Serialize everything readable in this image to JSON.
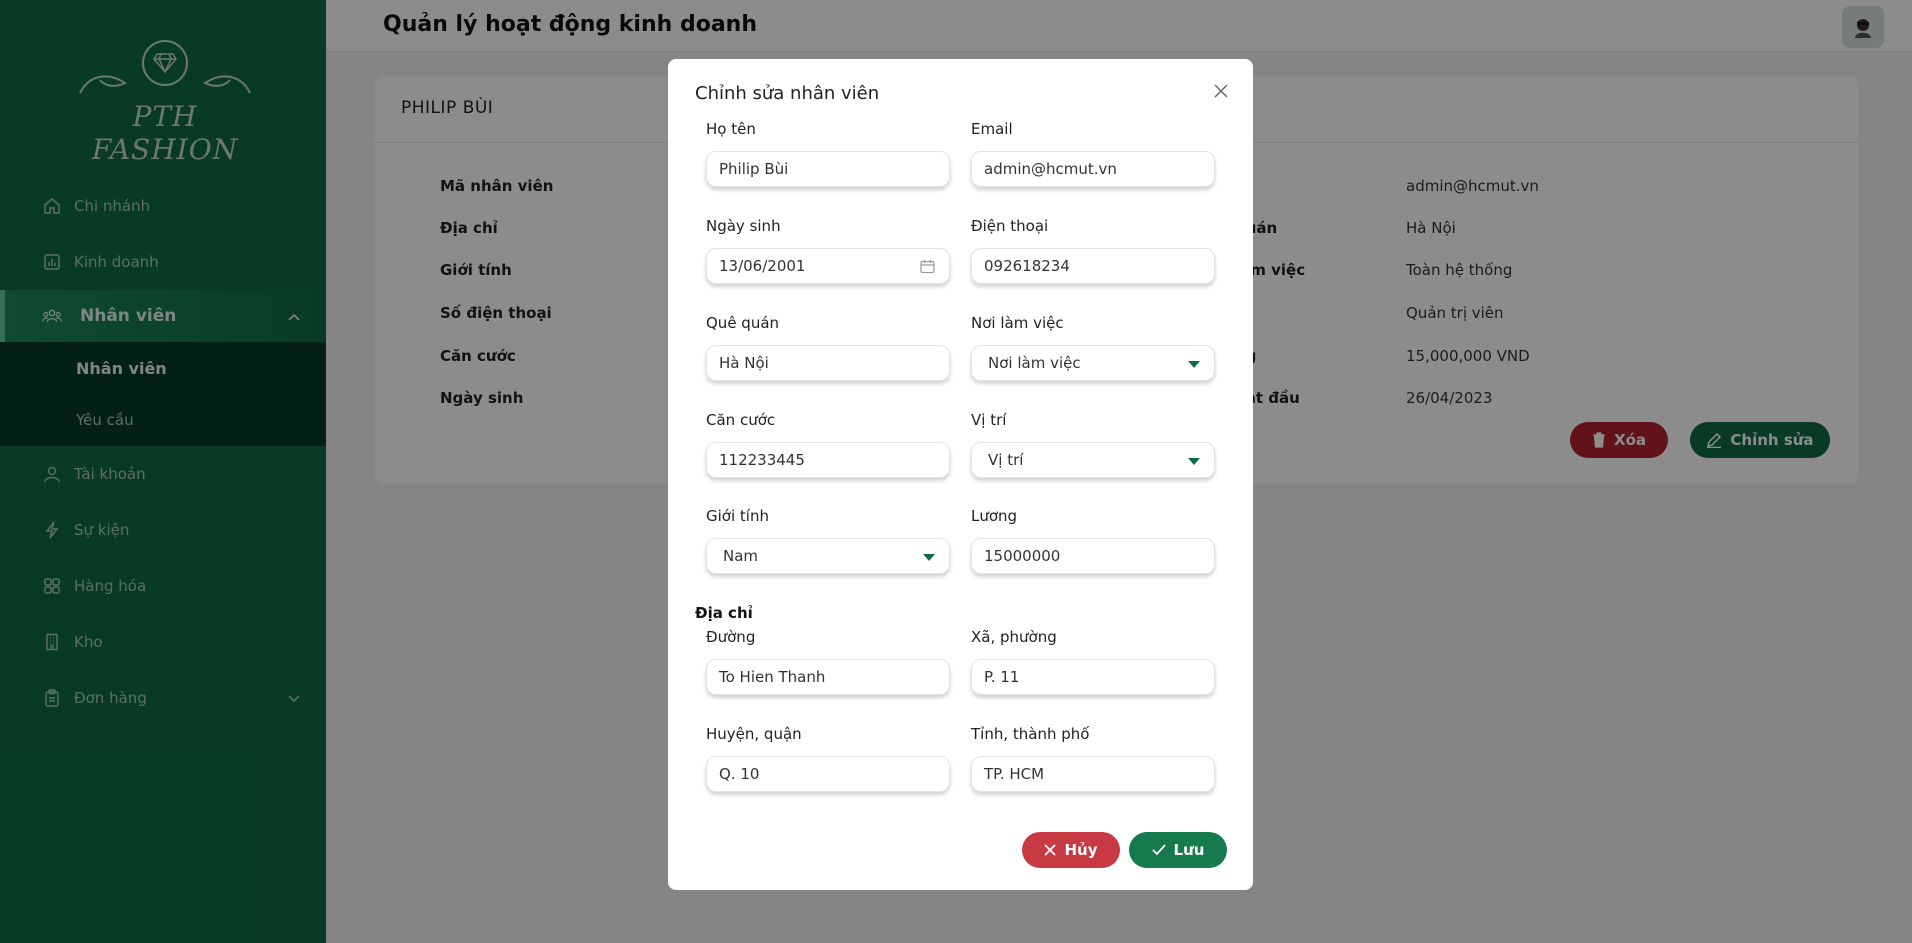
{
  "app": {
    "brand": "PTH FASHION",
    "header_title": "Quản lý hoạt động kinh doanh"
  },
  "sidebar": {
    "items": [
      {
        "label": "Chi nhánh",
        "icon": "home-icon"
      },
      {
        "label": "Kinh doanh",
        "icon": "bar-chart-icon"
      },
      {
        "label": "Nhân viên",
        "icon": "users-icon",
        "active": true
      },
      {
        "label": "Tài khoản",
        "icon": "user-icon"
      },
      {
        "label": "Sự kiện",
        "icon": "lightning-icon"
      },
      {
        "label": "Hàng hóa",
        "icon": "grid-icon"
      },
      {
        "label": "Kho",
        "icon": "building-icon"
      },
      {
        "label": "Đơn hàng",
        "icon": "clipboard-icon"
      }
    ],
    "subitems": [
      {
        "label": "Nhân viên",
        "active": true
      },
      {
        "label": "Yêu cầu"
      }
    ]
  },
  "detail": {
    "name": "PHILIP BÙI",
    "left_labels": [
      "Mã nhân viên",
      "Địa chỉ",
      "Giới tính",
      "Số điện thoại",
      "Căn cước",
      "Ngày sinh"
    ],
    "right_labels": [
      "",
      "quán",
      "làm việc",
      "",
      "ng",
      "bắt đầu"
    ],
    "right_values": [
      "admin@hcmut.vn",
      "Hà Nội",
      "Toàn hệ thống",
      "Quản trị viên",
      "15,000,000 VND",
      "26/04/2023"
    ],
    "delete_label": "Xóa",
    "edit_label": "Chỉnh sửa"
  },
  "modal": {
    "title": "Chỉnh sửa nhân viên",
    "fields": {
      "name": {
        "label": "Họ tên",
        "value": "Philip Bùi"
      },
      "email": {
        "label": "Email",
        "value": "admin@hcmut.vn"
      },
      "dob": {
        "label": "Ngày sinh",
        "value": "13/06/2001"
      },
      "phone": {
        "label": "Điện thoại",
        "value": "092618234"
      },
      "hometown": {
        "label": "Quê quán",
        "value": "Hà Nội"
      },
      "workplace": {
        "label": "Nơi làm việc",
        "value": "Nơi làm việc"
      },
      "id_card": {
        "label": "Căn cước",
        "value": "112233445"
      },
      "position": {
        "label": "Vị trí",
        "value": "Vị trí"
      },
      "gender": {
        "label": "Giới tính",
        "value": "Nam"
      },
      "salary": {
        "label": "Lương",
        "value": "15000000"
      }
    },
    "address_section": "Địa chỉ",
    "address": {
      "street": {
        "label": "Đường",
        "value": "To Hien Thanh"
      },
      "ward": {
        "label": "Xã, phường",
        "value": "P. 11"
      },
      "district": {
        "label": "Huyện, quận",
        "value": "Q. 10"
      },
      "city": {
        "label": "Tỉnh, thành phố",
        "value": "TP. HCM"
      }
    },
    "cancel_label": "Hủy",
    "save_label": "Lưu"
  },
  "colors": {
    "sidebar": "#0f6b45",
    "primary": "#157a4d",
    "danger": "#c83a43",
    "submenu": "#063b2b"
  }
}
